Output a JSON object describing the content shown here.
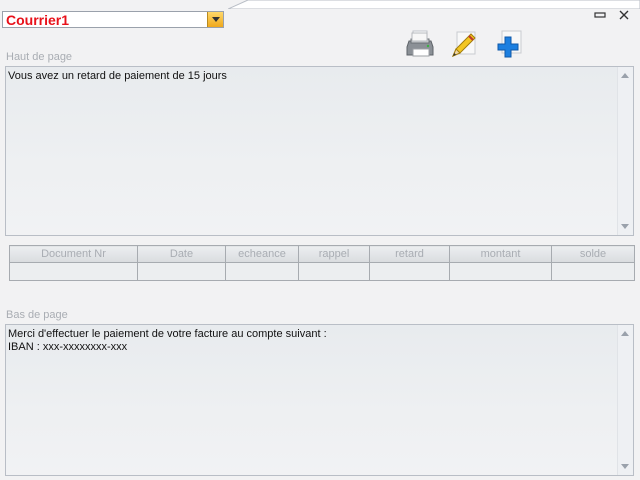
{
  "letter_select": {
    "value": "Courrier1"
  },
  "header_section": {
    "label": "Haut de page",
    "text": "Vous avez un retard de paiement de 15 jours"
  },
  "table": {
    "columns": [
      "Document Nr",
      "Date",
      "echeance",
      "rappel",
      "retard",
      "montant",
      "solde"
    ]
  },
  "footer_section": {
    "label": "Bas de page",
    "text": "Merci d'effectuer le paiement de votre facture au compte suivant :\nIBAN : xxx-xxxxxxxx-xxx"
  },
  "icons": {
    "print": "printer-icon",
    "edit": "pencil-icon",
    "add": "plus-icon",
    "minimize": "minimize-icon",
    "close": "close-icon"
  },
  "colors": {
    "combo_text": "#e8111a",
    "combo_arrow": "#f0a81c",
    "label": "#a9adb3",
    "add_icon": "#1c7fe0"
  }
}
